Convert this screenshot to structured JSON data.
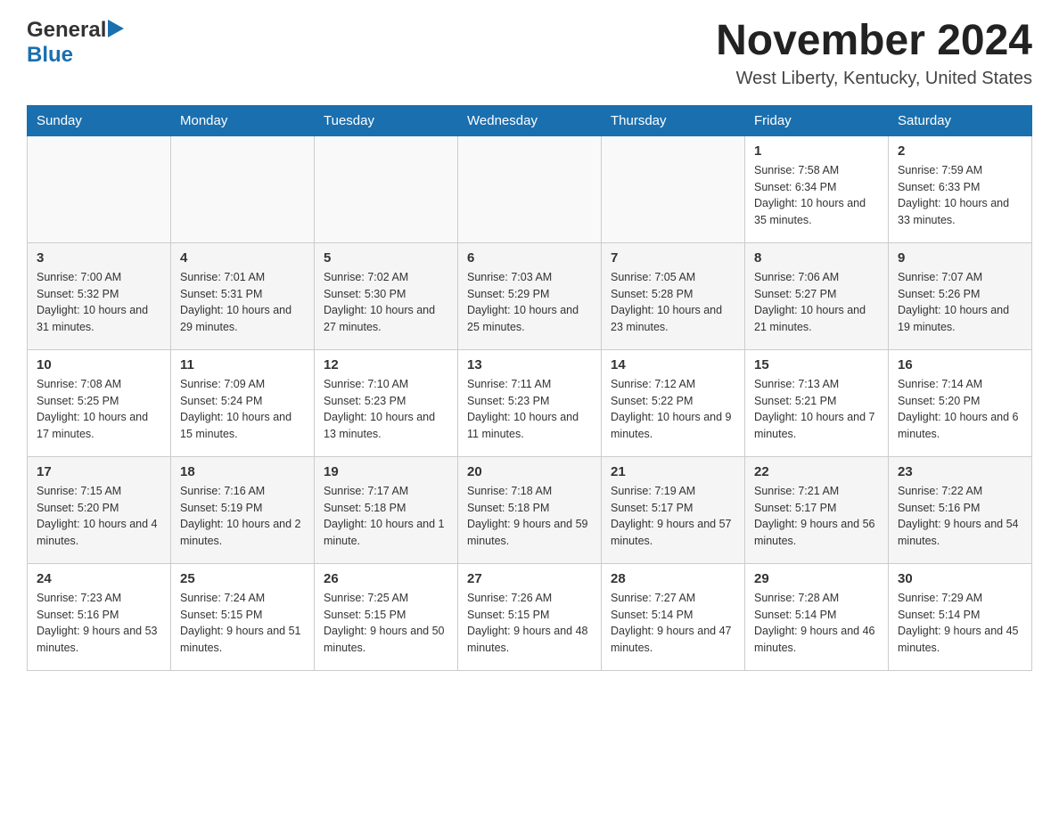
{
  "header": {
    "logo_general": "General",
    "logo_blue": "Blue",
    "title": "November 2024",
    "subtitle": "West Liberty, Kentucky, United States"
  },
  "calendar": {
    "days_of_week": [
      "Sunday",
      "Monday",
      "Tuesday",
      "Wednesday",
      "Thursday",
      "Friday",
      "Saturday"
    ],
    "weeks": [
      [
        {
          "day": "",
          "info": ""
        },
        {
          "day": "",
          "info": ""
        },
        {
          "day": "",
          "info": ""
        },
        {
          "day": "",
          "info": ""
        },
        {
          "day": "",
          "info": ""
        },
        {
          "day": "1",
          "info": "Sunrise: 7:58 AM\nSunset: 6:34 PM\nDaylight: 10 hours and 35 minutes."
        },
        {
          "day": "2",
          "info": "Sunrise: 7:59 AM\nSunset: 6:33 PM\nDaylight: 10 hours and 33 minutes."
        }
      ],
      [
        {
          "day": "3",
          "info": "Sunrise: 7:00 AM\nSunset: 5:32 PM\nDaylight: 10 hours and 31 minutes."
        },
        {
          "day": "4",
          "info": "Sunrise: 7:01 AM\nSunset: 5:31 PM\nDaylight: 10 hours and 29 minutes."
        },
        {
          "day": "5",
          "info": "Sunrise: 7:02 AM\nSunset: 5:30 PM\nDaylight: 10 hours and 27 minutes."
        },
        {
          "day": "6",
          "info": "Sunrise: 7:03 AM\nSunset: 5:29 PM\nDaylight: 10 hours and 25 minutes."
        },
        {
          "day": "7",
          "info": "Sunrise: 7:05 AM\nSunset: 5:28 PM\nDaylight: 10 hours and 23 minutes."
        },
        {
          "day": "8",
          "info": "Sunrise: 7:06 AM\nSunset: 5:27 PM\nDaylight: 10 hours and 21 minutes."
        },
        {
          "day": "9",
          "info": "Sunrise: 7:07 AM\nSunset: 5:26 PM\nDaylight: 10 hours and 19 minutes."
        }
      ],
      [
        {
          "day": "10",
          "info": "Sunrise: 7:08 AM\nSunset: 5:25 PM\nDaylight: 10 hours and 17 minutes."
        },
        {
          "day": "11",
          "info": "Sunrise: 7:09 AM\nSunset: 5:24 PM\nDaylight: 10 hours and 15 minutes."
        },
        {
          "day": "12",
          "info": "Sunrise: 7:10 AM\nSunset: 5:23 PM\nDaylight: 10 hours and 13 minutes."
        },
        {
          "day": "13",
          "info": "Sunrise: 7:11 AM\nSunset: 5:23 PM\nDaylight: 10 hours and 11 minutes."
        },
        {
          "day": "14",
          "info": "Sunrise: 7:12 AM\nSunset: 5:22 PM\nDaylight: 10 hours and 9 minutes."
        },
        {
          "day": "15",
          "info": "Sunrise: 7:13 AM\nSunset: 5:21 PM\nDaylight: 10 hours and 7 minutes."
        },
        {
          "day": "16",
          "info": "Sunrise: 7:14 AM\nSunset: 5:20 PM\nDaylight: 10 hours and 6 minutes."
        }
      ],
      [
        {
          "day": "17",
          "info": "Sunrise: 7:15 AM\nSunset: 5:20 PM\nDaylight: 10 hours and 4 minutes."
        },
        {
          "day": "18",
          "info": "Sunrise: 7:16 AM\nSunset: 5:19 PM\nDaylight: 10 hours and 2 minutes."
        },
        {
          "day": "19",
          "info": "Sunrise: 7:17 AM\nSunset: 5:18 PM\nDaylight: 10 hours and 1 minute."
        },
        {
          "day": "20",
          "info": "Sunrise: 7:18 AM\nSunset: 5:18 PM\nDaylight: 9 hours and 59 minutes."
        },
        {
          "day": "21",
          "info": "Sunrise: 7:19 AM\nSunset: 5:17 PM\nDaylight: 9 hours and 57 minutes."
        },
        {
          "day": "22",
          "info": "Sunrise: 7:21 AM\nSunset: 5:17 PM\nDaylight: 9 hours and 56 minutes."
        },
        {
          "day": "23",
          "info": "Sunrise: 7:22 AM\nSunset: 5:16 PM\nDaylight: 9 hours and 54 minutes."
        }
      ],
      [
        {
          "day": "24",
          "info": "Sunrise: 7:23 AM\nSunset: 5:16 PM\nDaylight: 9 hours and 53 minutes."
        },
        {
          "day": "25",
          "info": "Sunrise: 7:24 AM\nSunset: 5:15 PM\nDaylight: 9 hours and 51 minutes."
        },
        {
          "day": "26",
          "info": "Sunrise: 7:25 AM\nSunset: 5:15 PM\nDaylight: 9 hours and 50 minutes."
        },
        {
          "day": "27",
          "info": "Sunrise: 7:26 AM\nSunset: 5:15 PM\nDaylight: 9 hours and 48 minutes."
        },
        {
          "day": "28",
          "info": "Sunrise: 7:27 AM\nSunset: 5:14 PM\nDaylight: 9 hours and 47 minutes."
        },
        {
          "day": "29",
          "info": "Sunrise: 7:28 AM\nSunset: 5:14 PM\nDaylight: 9 hours and 46 minutes."
        },
        {
          "day": "30",
          "info": "Sunrise: 7:29 AM\nSunset: 5:14 PM\nDaylight: 9 hours and 45 minutes."
        }
      ]
    ]
  }
}
